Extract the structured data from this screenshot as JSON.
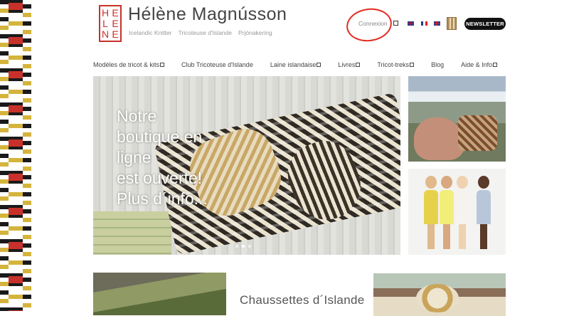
{
  "brand": {
    "logo_letters": [
      "H",
      "E",
      "L",
      "E",
      "N",
      "E"
    ],
    "title": "Hélène Magnússon",
    "taglines": [
      "Icelandic Knitter",
      "Tricoteuse d'Islande",
      "Prjónakering"
    ]
  },
  "header": {
    "login_label": "Connexion",
    "newsletter_label": "NEWSLETTER",
    "languages": [
      "English",
      "Français",
      "Íslenska"
    ]
  },
  "nav": {
    "items": [
      {
        "label": "Modèles de tricot & kits",
        "has_submenu": true
      },
      {
        "label": "Club Tricoteuse d'Islande",
        "has_submenu": false
      },
      {
        "label": "Laine islandaise",
        "has_submenu": true
      },
      {
        "label": "Livres",
        "has_submenu": true
      },
      {
        "label": "Tricot-treks",
        "has_submenu": true
      },
      {
        "label": "Blog",
        "has_submenu": false
      },
      {
        "label": "Aide & Info",
        "has_submenu": true
      }
    ]
  },
  "hero": {
    "lines": [
      "Notre",
      "boutique en",
      "ligne",
      "est ouverte!",
      "Plus d´info..."
    ],
    "slide_count": 3,
    "active_slide": 1
  },
  "bottom": {
    "middle_title": "Chaussettes d´Islande"
  },
  "colors": {
    "brand_red": "#c8312b",
    "annotation_circle": "#e32b22",
    "newsletter_bg": "#111111"
  }
}
